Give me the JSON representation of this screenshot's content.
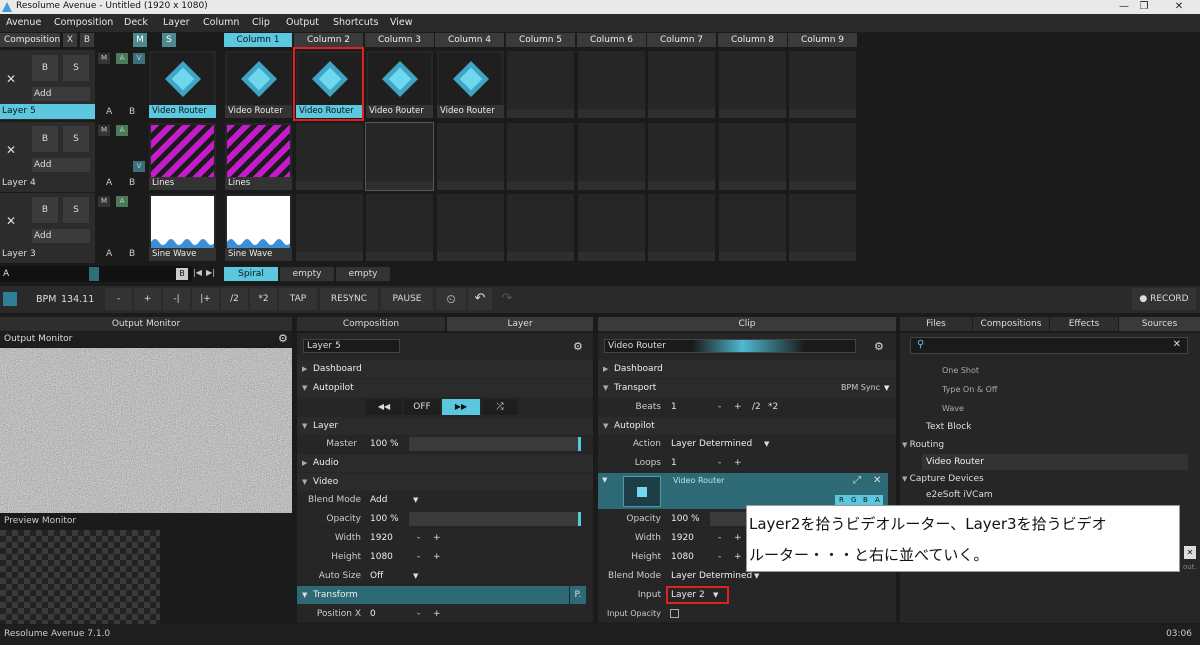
{
  "window": {
    "title": "Resolume Avenue - Untitled (1920 x 1080)"
  },
  "menu": [
    "Avenue",
    "Composition",
    "Deck",
    "Layer",
    "Column",
    "Clip",
    "Output",
    "Shortcuts",
    "View"
  ],
  "comp_bar": {
    "label": "Composition",
    "x": "X",
    "b": "B",
    "m": "M",
    "s": "S"
  },
  "columns": [
    "Column 1",
    "Column 2",
    "Column 3",
    "Column 4",
    "Column 5",
    "Column 6",
    "Column 7",
    "Column 8",
    "Column 9"
  ],
  "layers": [
    {
      "name": "Layer 5",
      "add": "Add",
      "b": "B",
      "s": "S",
      "clips": [
        "Video Router",
        "Video Router",
        "Video Router",
        "Video Router",
        "Video Router"
      ]
    },
    {
      "name": "Layer 4",
      "add": "Add",
      "b": "B",
      "s": "S",
      "clips": [
        "Lines",
        "Lines"
      ]
    },
    {
      "name": "Layer 3",
      "add": "Add",
      "b": "B",
      "s": "S",
      "clips": [
        "Sine Wave",
        "Sine Wave"
      ]
    }
  ],
  "deck": {
    "a": "A",
    "b": "B",
    "tabs": [
      "Spiral",
      "empty",
      "empty"
    ]
  },
  "transport": {
    "bpm_label": "BPM",
    "bpm": "134.11",
    "minus": "-",
    "plus": "+",
    "nudge_minus": "-|",
    "nudge_plus": "|+",
    "half": "/2",
    "double": "*2",
    "tap": "TAP",
    "resync": "RESYNC",
    "pause": "PAUSE",
    "record": "RECORD"
  },
  "output": {
    "header": "Output Monitor",
    "title": "Output Monitor",
    "preview": "Preview Monitor"
  },
  "layer_panel": {
    "tab_comp": "Composition",
    "tab_layer": "Layer",
    "name": "Layer 5",
    "dashboard": "Dashboard",
    "autopilot": "Autopilot",
    "off": "OFF",
    "layer_sec": "Layer",
    "master_k": "Master",
    "master_v": "100 %",
    "audio": "Audio",
    "video": "Video",
    "blend_k": "Blend Mode",
    "blend_v": "Add",
    "opacity_k": "Opacity",
    "opacity_v": "100 %",
    "width_k": "Width",
    "width_v": "1920",
    "height_k": "Height",
    "height_v": "1080",
    "autosize_k": "Auto Size",
    "autosize_v": "Off",
    "transform": "Transform",
    "p": "P.",
    "posx_k": "Position X",
    "posx_v": "0"
  },
  "clip_panel": {
    "tab": "Clip",
    "name": "Video Router",
    "dashboard": "Dashboard",
    "transport": "Transport",
    "bpmsync": "BPM Sync",
    "beats_k": "Beats",
    "beats_v": "1",
    "half": "/2",
    "double": "*2",
    "autopilot": "Autopilot",
    "action_k": "Action",
    "action_v": "Layer Determined",
    "loops_k": "Loops",
    "loops_v": "1",
    "effect": "Video Router",
    "rgba": [
      "R",
      "G",
      "B",
      "A"
    ],
    "opacity_k": "Opacity",
    "opacity_v": "100 %",
    "width_k": "Width",
    "width_v": "1920",
    "height_k": "Height",
    "height_v": "1080",
    "blend_k": "Blend Mode",
    "blend_v": "Layer Determined",
    "input_k": "Input",
    "input_v": "Layer 2",
    "inop_k": "Input Opacity"
  },
  "browser": {
    "tabs": [
      "Files",
      "Compositions",
      "Effects",
      "Sources"
    ],
    "items": [
      {
        "t": "One Shot",
        "lvl": 2
      },
      {
        "t": "Type On & Off",
        "lvl": 2
      },
      {
        "t": "Wave",
        "lvl": 2
      },
      {
        "t": "Text Block",
        "lvl": 1
      },
      {
        "t": "Routing",
        "lvl": 0
      },
      {
        "t": "Video Router",
        "lvl": 1
      },
      {
        "t": "Capture Devices",
        "lvl": 0
      },
      {
        "t": "e2eSoft iVCam",
        "lvl": 1
      }
    ],
    "clip": "out."
  },
  "annotation": {
    "line1": "Layer2を拾うビデオルーター、Layer3を拾うビデオ",
    "line2": "ルーター・・・と右に並べていく。"
  },
  "status": {
    "left": "Resolume Avenue 7.1.0",
    "right": "03:06"
  },
  "colors": {
    "accent": "#5cc8e0",
    "highlight": "#e12020",
    "stripes": "#c51cc9"
  }
}
